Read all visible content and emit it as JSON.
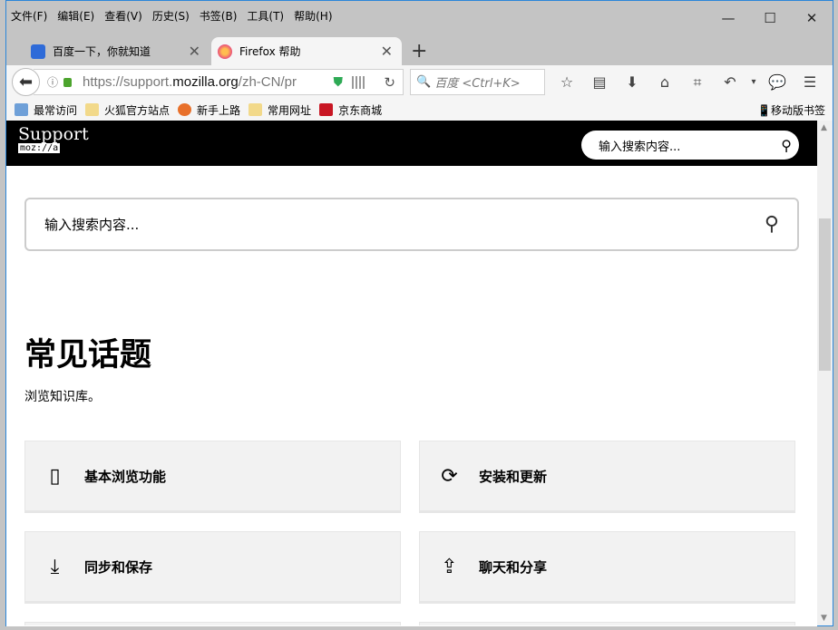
{
  "menu": [
    "文件(F)",
    "编辑(E)",
    "查看(V)",
    "历史(S)",
    "书签(B)",
    "工具(T)",
    "帮助(H)"
  ],
  "window_controls": {
    "minimize": "—",
    "maximize": "☐",
    "close": "✕"
  },
  "tabs": [
    {
      "title": "百度一下，你就知道"
    },
    {
      "title": "Firefox 帮助"
    }
  ],
  "new_tab": "+",
  "url": {
    "prefix": "https://support.",
    "domain": "mozilla.org",
    "suffix": "/zh-CN/pr"
  },
  "search_bar": {
    "placeholder": "百度 <Ctrl+K>"
  },
  "bookmarks": [
    {
      "label": "最常访问",
      "color": "#6fa0d8"
    },
    {
      "label": "火狐官方站点",
      "color": "#f2d98a"
    },
    {
      "label": "新手上路",
      "color": "#e8702a"
    },
    {
      "label": "常用网址",
      "color": "#f2d98a"
    },
    {
      "label": "京东商城",
      "color": "#c81623"
    }
  ],
  "mobile_bookmarks": "移动版书签",
  "site": {
    "logo": "Support",
    "logo_sub": "moz://a",
    "header_search_placeholder": "输入搜索内容...",
    "main_search_placeholder": "输入搜索内容...",
    "title": "常见话题",
    "subtitle": "浏览知识库。",
    "topics": [
      {
        "label": "基本浏览功能",
        "icon": "book-icon"
      },
      {
        "label": "安装和更新",
        "icon": "sync-icon"
      },
      {
        "label": "同步和保存",
        "icon": "cloud-download-icon"
      },
      {
        "label": "聊天和分享",
        "icon": "share-upload-icon"
      }
    ]
  }
}
